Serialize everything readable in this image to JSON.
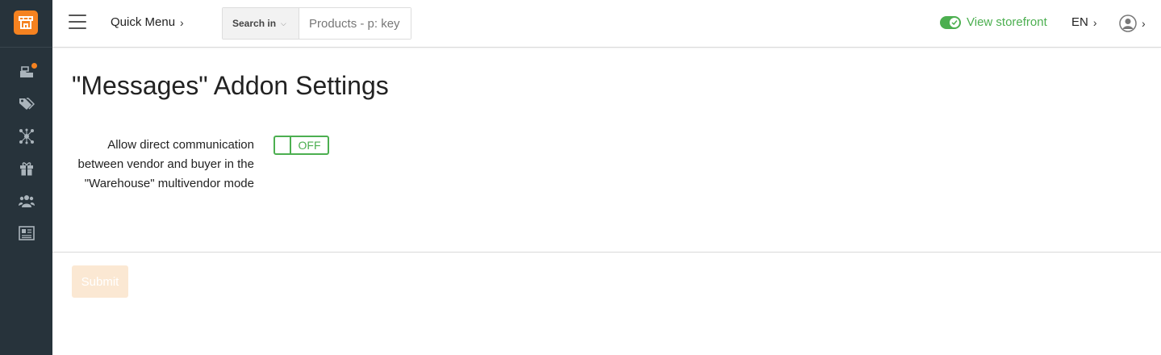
{
  "sidebar": {
    "logo_icon": "store-logo-icon",
    "accent_color": "#f58220",
    "items": [
      {
        "icon": "orders-icon",
        "has_badge": true
      },
      {
        "icon": "tags-icon",
        "has_badge": false
      },
      {
        "icon": "network-icon",
        "has_badge": false
      },
      {
        "icon": "gift-icon",
        "has_badge": false
      },
      {
        "icon": "users-icon",
        "has_badge": false
      },
      {
        "icon": "news-icon",
        "has_badge": false
      }
    ]
  },
  "header": {
    "quick_menu_label": "Quick Menu",
    "search": {
      "scope_label": "Search in",
      "placeholder": "Products - p: key"
    },
    "storefront_label": "View storefront",
    "storefront_color": "#4caf50",
    "language": "EN"
  },
  "main": {
    "title": "\"Messages\" Addon Settings",
    "setting": {
      "label": "Allow direct communication between vendor and buyer in the \"Warehouse\" multivendor mode",
      "state": "OFF"
    },
    "submit_label": "Submit"
  }
}
